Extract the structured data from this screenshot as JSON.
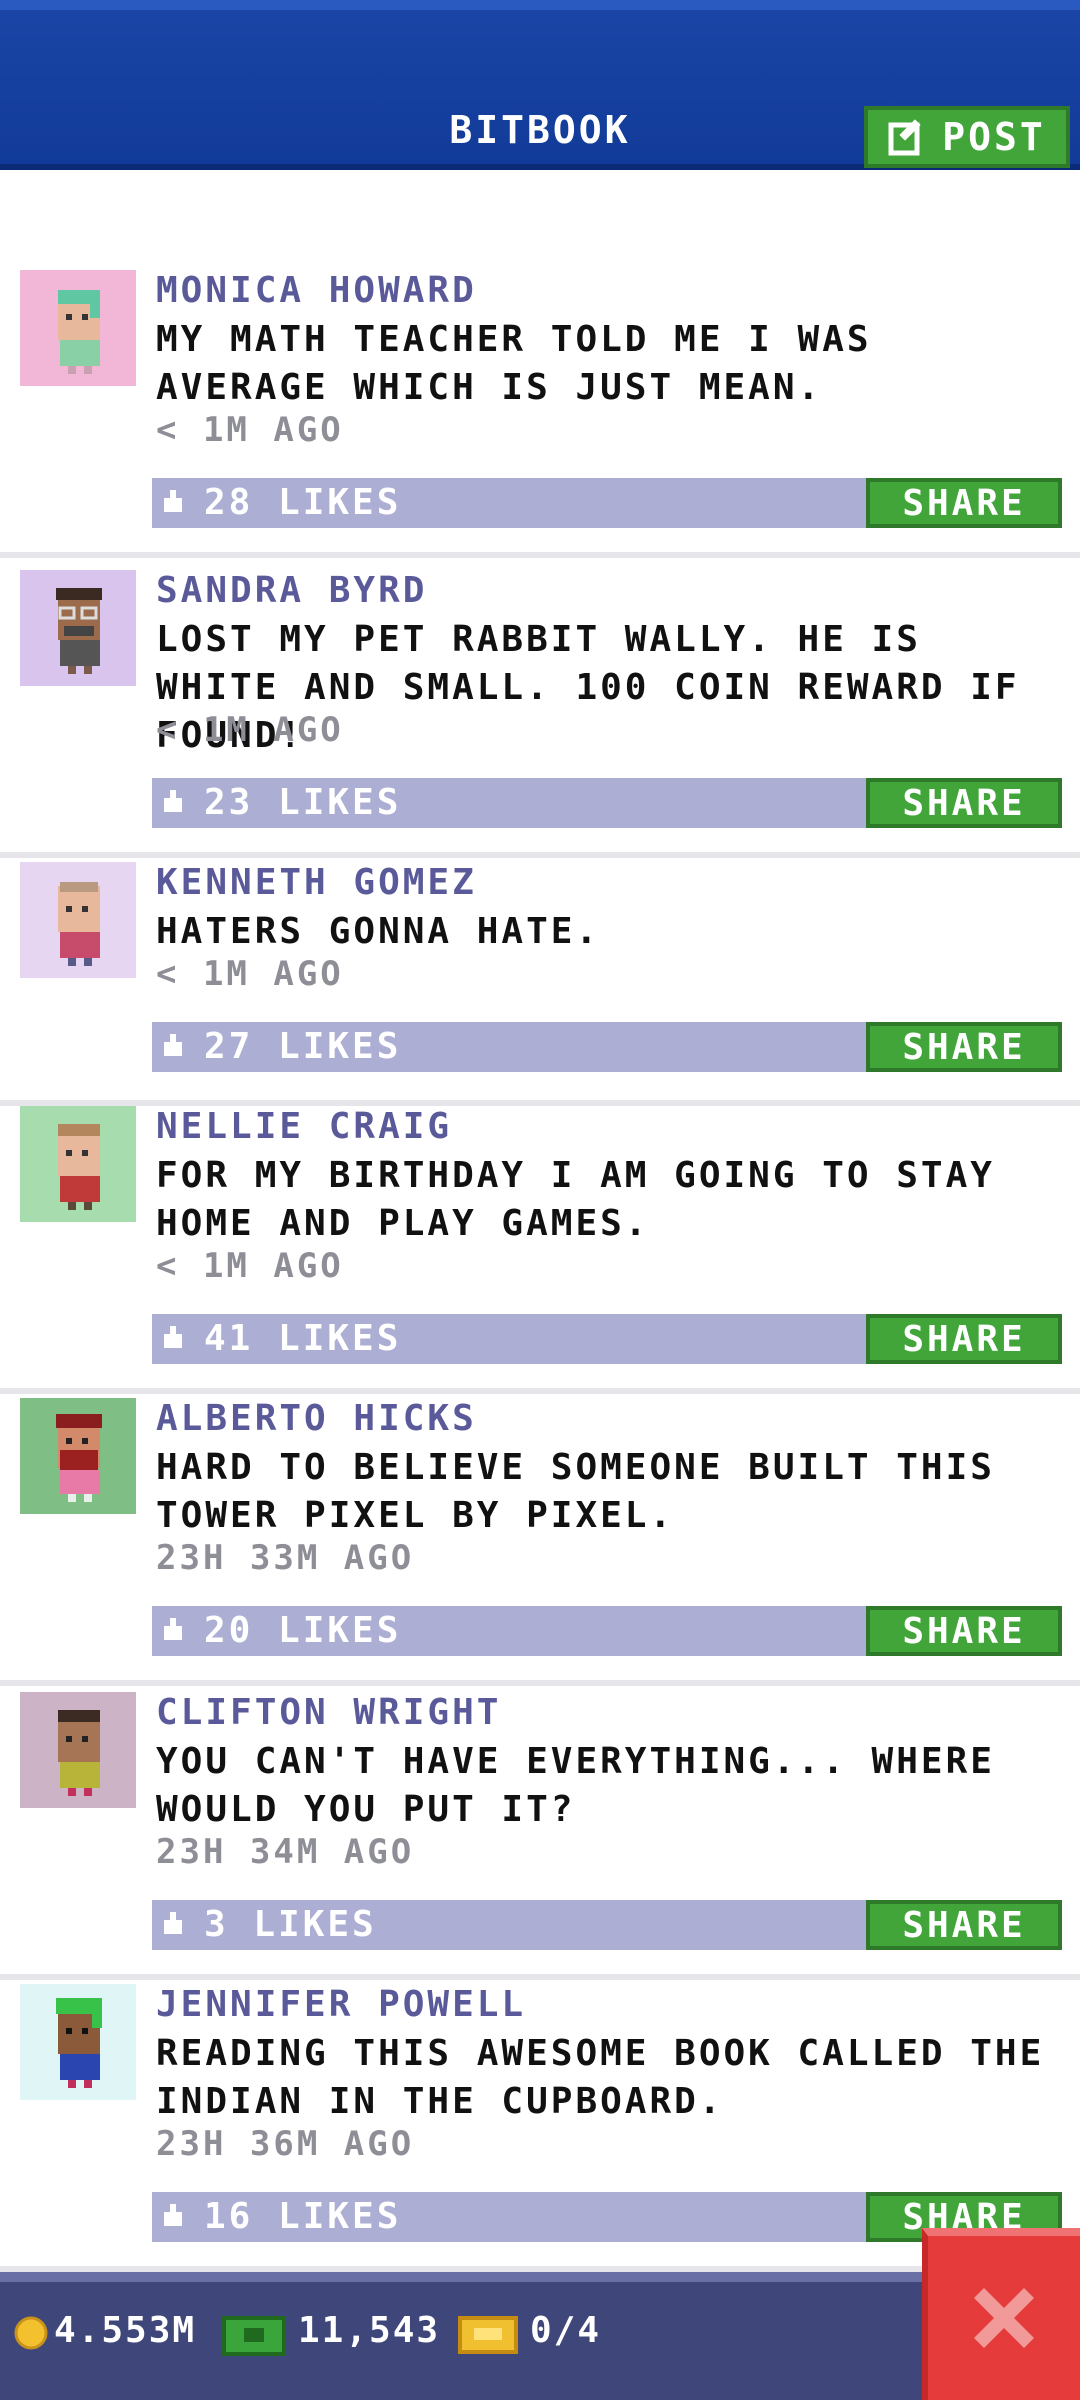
{
  "header": {
    "title": "BITBOOK",
    "post_label": "POST"
  },
  "posts": [
    {
      "name": "MONICA HOWARD",
      "message": "MY MATH TEACHER TOLD ME I WAS AVERAGE WHICH IS JUST MEAN.",
      "time": "< 1M AGO",
      "likes": "28 LIKES",
      "share": "SHARE",
      "avatar_bg": "#f2b6d6"
    },
    {
      "name": "SANDRA BYRD",
      "message": "LOST MY PET RABBIT WALLY. HE IS WHITE AND SMALL. 100 COIN REWARD IF FOUND!",
      "time": "< 1M AGO",
      "likes": "23 LIKES",
      "share": "SHARE",
      "avatar_bg": "#d9c4ee"
    },
    {
      "name": "KENNETH GOMEZ",
      "message": "HATERS GONNA HATE.",
      "time": "< 1M AGO",
      "likes": "27 LIKES",
      "share": "SHARE",
      "avatar_bg": "#e6d6f2"
    },
    {
      "name": "NELLIE CRAIG",
      "message": "FOR MY BIRTHDAY I AM GOING TO STAY HOME AND PLAY GAMES.",
      "time": "< 1M AGO",
      "likes": "41 LIKES",
      "share": "SHARE",
      "avatar_bg": "#a6dcae"
    },
    {
      "name": "ALBERTO HICKS",
      "message": "HARD TO BELIEVE SOMEONE BUILT THIS TOWER PIXEL BY PIXEL.",
      "time": "23H 33M AGO",
      "likes": "20 LIKES",
      "share": "SHARE",
      "avatar_bg": "#7fbf86"
    },
    {
      "name": "CLIFTON WRIGHT",
      "message": "YOU CAN'T HAVE EVERYTHING... WHERE WOULD YOU PUT IT?",
      "time": "23H 34M AGO",
      "likes": "3 LIKES",
      "share": "SHARE",
      "avatar_bg": "#cdb3c6"
    },
    {
      "name": "JENNIFER POWELL",
      "message": "READING THIS AWESOME BOOK CALLED THE INDIAN IN THE CUPBOARD.",
      "time": "23H 36M AGO",
      "likes": "16 LIKES",
      "share": "SHARE",
      "avatar_bg": "#dff5f6"
    }
  ],
  "footer": {
    "coins": "4.553M",
    "bux": "11,543",
    "tickets": "0/4"
  },
  "colors": {
    "header_blue": "#123b99",
    "share_green": "#41a53a",
    "like_bar": "#adaed3",
    "close_red": "#e53b3b"
  }
}
